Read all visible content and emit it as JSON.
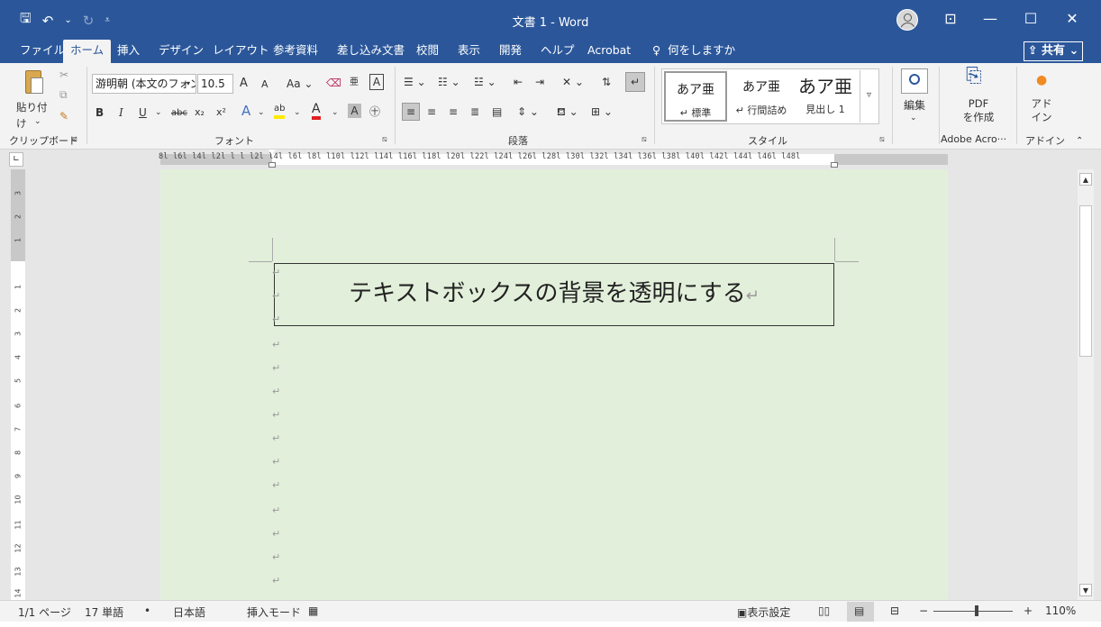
{
  "title_bar": {
    "doc_title": "文書 1  -  Word",
    "qat": {
      "save": "🖫",
      "undo": "↶",
      "undo_dd": "⌄",
      "redo": "↻",
      "customize": "⩡"
    },
    "window": {
      "ribbon_display": "⊡",
      "minimize": "—",
      "maximize": "☐",
      "close": "✕"
    }
  },
  "tabs": [
    "ファイル",
    "ホーム",
    "挿入",
    "デザイン",
    "レイアウト",
    "参考資料",
    "差し込み文書",
    "校閲",
    "表示",
    "開発",
    "ヘルプ",
    "Acrobat"
  ],
  "tell_me": "何をしますか",
  "share_label": "共有",
  "ribbon": {
    "clipboard": {
      "paste": "貼り付け",
      "label": "クリップボード"
    },
    "font": {
      "name": "游明朝 (本文のフォン",
      "size": "10.5",
      "grow": "A",
      "shrink": "A",
      "case": "Aa",
      "bold": "B",
      "italic": "I",
      "underline": "U",
      "strike": "abc",
      "sub": "x₂",
      "sup": "x²",
      "effects": "A",
      "highlight": "ab",
      "color": "A",
      "shade": "A",
      "enclose": "㊉",
      "label": "フォント"
    },
    "paragraph": {
      "label": "段落"
    },
    "styles": {
      "items": [
        {
          "sample": "あア亜",
          "name": "↵ 標準"
        },
        {
          "sample": "あア亜",
          "name": "↵ 行間詰め"
        },
        {
          "sample": "あア亜",
          "name": "見出し 1"
        }
      ],
      "label": "スタイル"
    },
    "editing": {
      "label": "編集"
    },
    "adobe": {
      "button": "PDF\nを作成",
      "label": "Adobe Acro···"
    },
    "addin": {
      "button": "アド\nイン",
      "label": "アドイン"
    }
  },
  "ruler_numbers": "8l l6l l4l l2l l   l l2l l4l l6l l8l l10l l12l l14l l16l l18l l20l l22l l24l l26l l28l l30l l32l l34l l36l l38l l40l l42l l44l l46l l48l",
  "vruler_numbers": [
    "3",
    "2",
    "1",
    "1",
    "2",
    "3",
    "4",
    "5",
    "6",
    "7",
    "8",
    "9",
    "10",
    "11",
    "12",
    "13",
    "14"
  ],
  "document": {
    "textbox_text": "テキストボックスの背景を透明にする",
    "return_mark": "↵"
  },
  "status": {
    "page": "1/1 ページ",
    "words": "17 単語",
    "lang": "日本語",
    "mode": "挿入モード",
    "display_settings": "表示設定",
    "zoom": "110%",
    "zoom_minus": "−",
    "zoom_plus": "+"
  }
}
